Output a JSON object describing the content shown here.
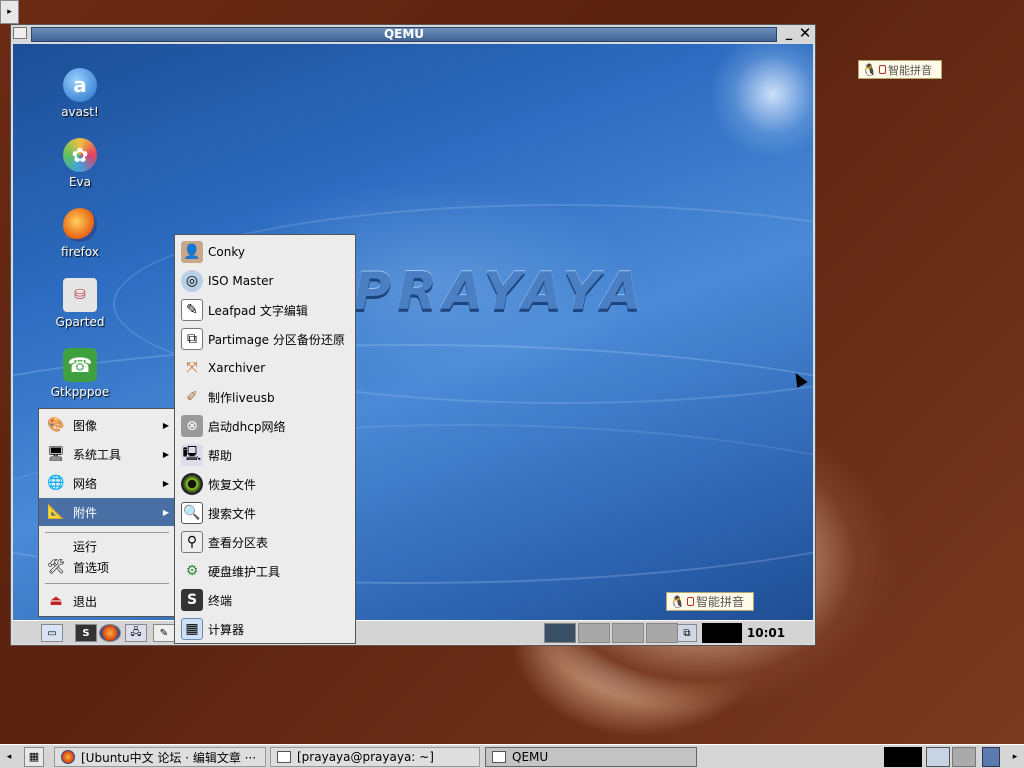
{
  "host": {
    "corner_button": "▸",
    "ime_label": "智能拼音",
    "taskbar": {
      "tasks": [
        {
          "label": "[Ubuntu中文 论坛 · 编辑文章 ···",
          "icon": "firefox-icon"
        },
        {
          "label": "[prayaya@prayaya: ~]",
          "icon": "terminal-icon"
        },
        {
          "label": "QEMU",
          "icon": "window-icon"
        }
      ]
    }
  },
  "qemu": {
    "title": "QEMU",
    "minimize": "_",
    "close": "✕"
  },
  "guest": {
    "brand_text": "PRAYAYA",
    "desktop_icons": [
      {
        "label": "avast!",
        "icon": "avast-icon"
      },
      {
        "label": "Eva",
        "icon": "eva-icon"
      },
      {
        "label": "firefox",
        "icon": "firefox-icon"
      },
      {
        "label": "Gparted",
        "icon": "gparted-icon"
      },
      {
        "label": "Gtkpppoe",
        "icon": "phone-icon"
      }
    ],
    "ime_label": "智能拼音",
    "clock": "10:01",
    "main_menu": {
      "items": [
        {
          "label": "图像",
          "has_submenu": true
        },
        {
          "label": "系统工具",
          "has_submenu": true
        },
        {
          "label": "网络",
          "has_submenu": true
        },
        {
          "label": "附件",
          "has_submenu": true,
          "selected": true
        }
      ],
      "run_label": "运行",
      "prefs_label": "首选项",
      "exit_label": "退出"
    },
    "sub_menu": {
      "items": [
        "Conky",
        "ISO Master",
        "Leafpad 文字编辑",
        "Partimage 分区备份还原",
        "Xarchiver",
        "制作liveusb",
        "启动dhcp网络",
        "帮助",
        "恢复文件",
        "搜索文件",
        "查看分区表",
        "硬盘维护工具",
        "终端",
        "计算器"
      ]
    }
  },
  "colors": {
    "menu_selected": "#4a6fa5",
    "title_bar": "#3f6394"
  }
}
